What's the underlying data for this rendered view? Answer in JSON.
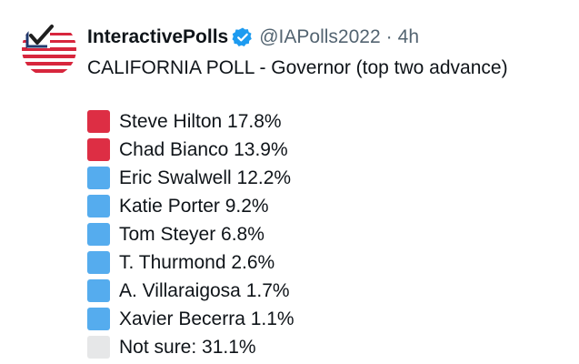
{
  "author": {
    "display_name": "InteractivePolls",
    "handle": "@IAPolls2022",
    "separator": "·",
    "time": "4h",
    "avatar_icon": "flag-checkmark-avatar-icon",
    "verified_icon": "verified-badge-icon",
    "verified_color": "#1d9bf0"
  },
  "tweet": {
    "headline": "CALIFORNIA POLL - Governor (top two advance)"
  },
  "colors": {
    "red": "#dd2e44",
    "blue": "#55acee",
    "gray": "#e6e7e8"
  },
  "poll": {
    "items": [
      {
        "text": "Steve Hilton 17.8%",
        "square": "red"
      },
      {
        "text": "Chad Bianco 13.9%",
        "square": "red"
      },
      {
        "text": "Eric Swalwell 12.2%",
        "square": "blue"
      },
      {
        "text": "Katie Porter 9.2%",
        "square": "blue"
      },
      {
        "text": "Tom Steyer 6.8%",
        "square": "blue"
      },
      {
        "text": "T. Thurmond 2.6%",
        "square": "blue"
      },
      {
        "text": "A. Villaraigosa 1.7%",
        "square": "blue"
      },
      {
        "text": "Xavier Becerra 1.1%",
        "square": "blue"
      },
      {
        "text": "Not sure: 31.1%",
        "square": "gray"
      }
    ]
  }
}
